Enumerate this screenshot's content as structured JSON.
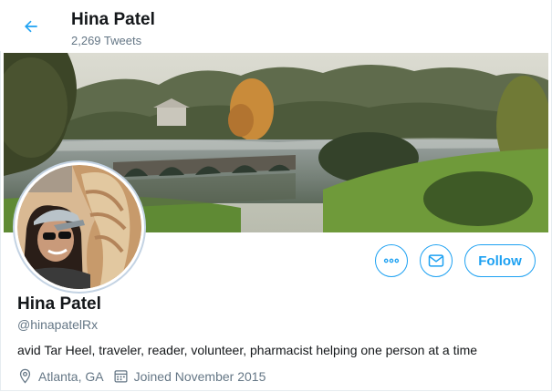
{
  "header": {
    "name": "Hina Patel",
    "tweet_count": "2,269 Tweets",
    "back_icon": "arrow-left-icon"
  },
  "profile": {
    "display_name": "Hina Patel",
    "handle": "@hinapatelRx",
    "bio": "avid Tar Heel, traveler, reader, volunteer, pharmacist helping one person at a time",
    "location": "Atlanta, GA",
    "joined": "Joined November 2015"
  },
  "actions": {
    "more_icon": "more-icon",
    "message_icon": "envelope-icon",
    "follow_label": "Follow"
  },
  "colors": {
    "accent": "#1da1f2",
    "secondary_text": "#657786",
    "primary_text": "#14171a"
  }
}
